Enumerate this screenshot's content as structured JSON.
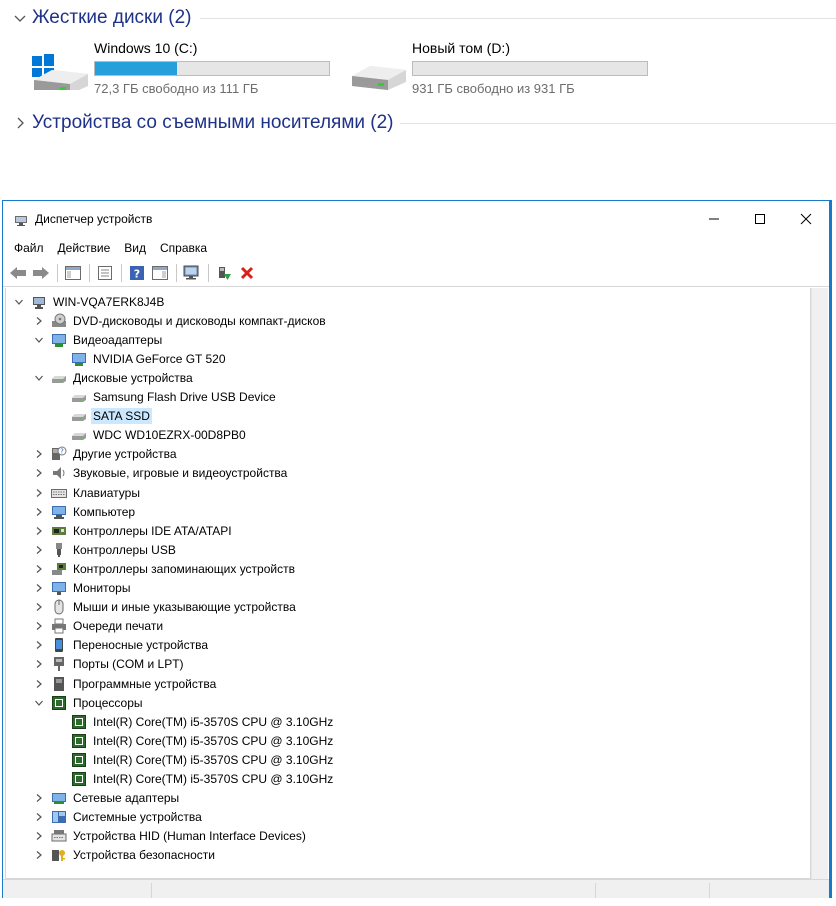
{
  "explorer": {
    "hard_disks_header": "Жесткие диски (2)",
    "removable_header": "Устройства со съемными носителями (2)",
    "drives": [
      {
        "name": "Windows 10 (C:)",
        "free_text": "72,3 ГБ свободно из 111 ГБ",
        "used_fraction": 0.35,
        "icon": "windows-drive-icon"
      },
      {
        "name": "Новый том (D:)",
        "free_text": "931 ГБ свободно из 931 ГБ",
        "used_fraction": 0.0,
        "icon": "drive-icon"
      }
    ]
  },
  "window": {
    "title": "Диспетчер устройств",
    "controls": {
      "minimize": "—",
      "maximize": "☐",
      "close": "✕"
    }
  },
  "menu": [
    "Файл",
    "Действие",
    "Вид",
    "Справка"
  ],
  "toolbar_icons": [
    "back-icon",
    "forward-icon",
    "show-hide-console-tree-icon",
    "properties-icon",
    "help-icon",
    "action-pane-icon",
    "scan-hardware-icon",
    "update-driver-icon",
    "uninstall-device-icon"
  ],
  "tree": {
    "root": "WIN-VQA7ERK8J4B",
    "nodes": [
      {
        "label": "DVD-дисководы и дисководы компакт-дисков",
        "icon": "dvd-drive-icon",
        "expanded": false,
        "level": 1
      },
      {
        "label": "Видеоадаптеры",
        "icon": "display-adapter-icon",
        "expanded": true,
        "level": 1
      },
      {
        "label": "NVIDIA GeForce GT 520",
        "icon": "display-adapter-icon",
        "level": 2
      },
      {
        "label": "Дисковые устройства",
        "icon": "disk-drive-icon",
        "expanded": true,
        "level": 1
      },
      {
        "label": "Samsung Flash Drive USB Device",
        "icon": "disk-drive-icon",
        "level": 2
      },
      {
        "label": "SATA SSD",
        "icon": "disk-drive-icon",
        "level": 2,
        "selected": true
      },
      {
        "label": "WDC WD10EZRX-00D8PB0",
        "icon": "disk-drive-icon",
        "level": 2
      },
      {
        "label": "Другие устройства",
        "icon": "other-devices-icon",
        "expanded": false,
        "level": 1
      },
      {
        "label": "Звуковые, игровые и видеоустройства",
        "icon": "speaker-icon",
        "expanded": false,
        "level": 1
      },
      {
        "label": "Клавиатуры",
        "icon": "keyboard-icon",
        "expanded": false,
        "level": 1
      },
      {
        "label": "Компьютер",
        "icon": "computer-icon",
        "expanded": false,
        "level": 1
      },
      {
        "label": "Контроллеры IDE ATA/ATAPI",
        "icon": "ide-controller-icon",
        "expanded": false,
        "level": 1
      },
      {
        "label": "Контроллеры USB",
        "icon": "usb-icon",
        "expanded": false,
        "level": 1
      },
      {
        "label": "Контроллеры запоминающих устройств",
        "icon": "storage-controller-icon",
        "expanded": false,
        "level": 1
      },
      {
        "label": "Мониторы",
        "icon": "monitor-icon",
        "expanded": false,
        "level": 1
      },
      {
        "label": "Мыши и иные указывающие устройства",
        "icon": "mouse-icon",
        "expanded": false,
        "level": 1
      },
      {
        "label": "Очереди печати",
        "icon": "printer-icon",
        "expanded": false,
        "level": 1
      },
      {
        "label": "Переносные устройства",
        "icon": "portable-device-icon",
        "expanded": false,
        "level": 1
      },
      {
        "label": "Порты (COM и LPT)",
        "icon": "port-icon",
        "expanded": false,
        "level": 1
      },
      {
        "label": "Программные устройства",
        "icon": "software-device-icon",
        "expanded": false,
        "level": 1
      },
      {
        "label": "Процессоры",
        "icon": "processor-icon",
        "expanded": true,
        "level": 1
      },
      {
        "label": "Intel(R) Core(TM) i5-3570S CPU @ 3.10GHz",
        "icon": "processor-icon",
        "level": 2
      },
      {
        "label": "Intel(R) Core(TM) i5-3570S CPU @ 3.10GHz",
        "icon": "processor-icon",
        "level": 2
      },
      {
        "label": "Intel(R) Core(TM) i5-3570S CPU @ 3.10GHz",
        "icon": "processor-icon",
        "level": 2
      },
      {
        "label": "Intel(R) Core(TM) i5-3570S CPU @ 3.10GHz",
        "icon": "processor-icon",
        "level": 2
      },
      {
        "label": "Сетевые адаптеры",
        "icon": "network-adapter-icon",
        "expanded": false,
        "level": 1
      },
      {
        "label": "Системные устройства",
        "icon": "system-device-icon",
        "expanded": false,
        "level": 1
      },
      {
        "label": "Устройства HID (Human Interface Devices)",
        "icon": "hid-icon",
        "expanded": false,
        "level": 1
      },
      {
        "label": "Устройства безопасности",
        "icon": "security-device-icon",
        "expanded": false,
        "level": 1
      }
    ]
  },
  "colors": {
    "accent": "#1979ca",
    "header_text": "#1e3287",
    "progress_fill": "#26a0da",
    "selection": "#cce8ff",
    "uninstall_red": "#d9201b"
  }
}
